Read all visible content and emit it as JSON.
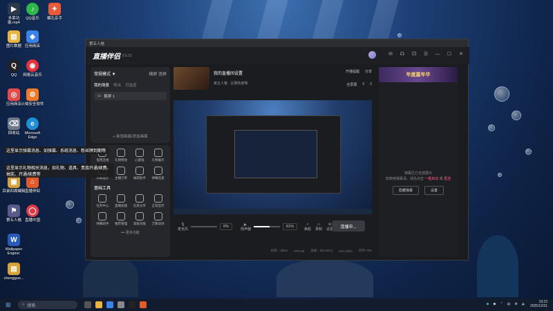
{
  "desktop": {
    "icons": [
      {
        "label": "多莱功能.mp4",
        "color": "#2b3a4a",
        "glyph": "▶"
      },
      {
        "label": "QQ音乐",
        "color": "#2fb84a",
        "glyph": "♪"
      },
      {
        "label": "模孔杂手",
        "color": "#e85a3a",
        "glyph": "✦"
      },
      {
        "label": "图片数据",
        "color": "#e8b542",
        "glyph": "▤"
      },
      {
        "label": "应用商店",
        "color": "#3a82e8",
        "glyph": "◈"
      },
      {
        "label": "QQ",
        "color": "#222",
        "glyph": "Q"
      },
      {
        "label": "网易云音乐",
        "color": "#e8313a",
        "glyph": "◉"
      },
      {
        "label": "应用商店",
        "color": "#e84a4a",
        "glyph": "◎"
      },
      {
        "label": "火绒安全软件",
        "color": "#f07a2a",
        "glyph": "⚙"
      },
      {
        "label": "回收站",
        "color": "#6c7a8a",
        "glyph": "⌫"
      },
      {
        "label": "Microsoft Edge",
        "color": "#1f8fd6",
        "glyph": "e"
      },
      {
        "label": "目录四周编辑",
        "color": "#d6a33a",
        "glyph": "▣"
      },
      {
        "label": "直播伴侣",
        "color": "#e05a2a",
        "glyph": "⌂"
      },
      {
        "label": "第五人格",
        "color": "#5a5a8a",
        "glyph": "⚑"
      },
      {
        "label": "直播中国",
        "color": "#e03a4a",
        "glyph": "◯"
      },
      {
        "label": "Wallpaper Engine:",
        "color": "#2a5ab8",
        "glyph": "W"
      },
      {
        "label": "chengguo...",
        "color": "#d6a33a",
        "glyph": "▤"
      }
    ],
    "tooltip_lines": [
      "这里显示弹幕消息、如弹幕、系统消息、粉丝牌到期等",
      "这里显示礼物相关消息，如礼物、道具、贵族开通/续费、抽奖、开通/续费等"
    ]
  },
  "window": {
    "title": "第五人格",
    "app_name": "直播伴侣",
    "version": "8.5.52",
    "scene": {
      "header": "常规模式 ▼",
      "header_right": "横屏  竖屏",
      "tabs": [
        "我的场景",
        "导出",
        "可选道"
      ],
      "source_item": "截屏 1",
      "add_source": "+ 新增画面/添加画面"
    },
    "tools": {
      "row1": [
        "电用连线",
        "礼物特效",
        "心愿墙",
        "礼物展示"
      ],
      "row2": [
        "弹幕抽奖",
        "主播订单",
        "福袋助手",
        "弹幕连麦"
      ],
      "basic_title": "基础工具",
      "row3": [
        "任务中心",
        "直播加速",
        "信息分享",
        "正常显示"
      ],
      "row4": [
        "弹幕助手",
        "推荐管理",
        "高级功能",
        "万象动效"
      ],
      "more": "••• 更多功能"
    },
    "room": {
      "title": "我的直播间设置",
      "subtitle": "第五人格 · 比赛热度等"
    },
    "top_actions": [
      "开播提醒",
      "分享"
    ],
    "top_actions2": [
      "全屏展",
      "0",
      "0"
    ],
    "controls": {
      "mic_label": "麦克风",
      "mic_pct": "0%",
      "speaker_label": "扬声器",
      "speaker_pct": "61%",
      "mic_value": 0,
      "speaker_value": 0.61,
      "effects": [
        "美颜",
        "录制",
        "设置"
      ],
      "live_button": "连播中..."
    },
    "status": [
      "码率：0kb/s",
      "FPS:30",
      "丢帧：0(0.00%)",
      "CPU:28%",
      "内存:73%"
    ],
    "right_panel": {
      "banner": "年度嘉年华",
      "message": "弹幕区已全部展示",
      "message2": "如使用弹幕请，请先点击",
      "link1": "一键启动",
      "link_sep": "或",
      "link2": "重连",
      "btn1": "隐藏弹幕",
      "btn2": "设置"
    }
  },
  "taskbar": {
    "search_placeholder": "搜索",
    "time": "19:23",
    "date": "2025/12/31",
    "lang": "中"
  }
}
